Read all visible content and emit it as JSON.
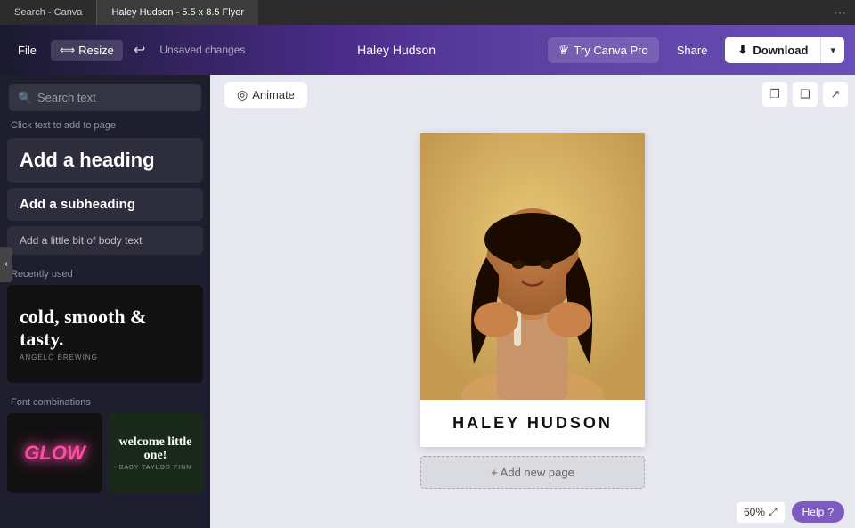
{
  "browser": {
    "tab1": "Search - Canva",
    "tab2": "Haley Hudson - 5.5 x 8.5 Flyer",
    "dots": "⋯"
  },
  "header": {
    "file_label": "File",
    "resize_label": "Resize",
    "resize_icon": "⟺",
    "undo_icon": "↩",
    "unsaved_label": "Unsaved changes",
    "doc_title": "Haley Hudson",
    "try_pro_label": "Try Canva Pro",
    "crown_icon": "♛",
    "share_label": "Share",
    "download_label": "Download",
    "download_icon": "⬇",
    "download_arrow": "▾"
  },
  "sidebar": {
    "search_placeholder": "Search text",
    "search_icon": "🔍",
    "click_hint": "Click text to add to page",
    "add_heading": "Add a heading",
    "add_subheading": "Add a subheading",
    "add_body": "Add a little bit of body text",
    "recently_used_label": "Recently used",
    "recently_used_text": "cold, smooth & tasty.",
    "recently_used_sub": "ANGELO BREWING",
    "font_combos_label": "Font combinations",
    "glow_text": "GLOW",
    "welcome_big": "welcome little one!",
    "welcome_small": "BABY TAYLOR FINN"
  },
  "canvas": {
    "animate_label": "Animate",
    "animate_icon": "◎",
    "doc_name": "HALEY HUDSON",
    "add_page_label": "+ Add new page",
    "zoom": "60%",
    "zoom_icon": "⤢",
    "help_label": "Help",
    "help_icon": "?",
    "tools": [
      "❐",
      "❑",
      "↗"
    ]
  },
  "accent_colors": {
    "purple": "#7c5cbf",
    "purple_dark": "#4a2c8a",
    "download_bg": "#ffffff"
  }
}
